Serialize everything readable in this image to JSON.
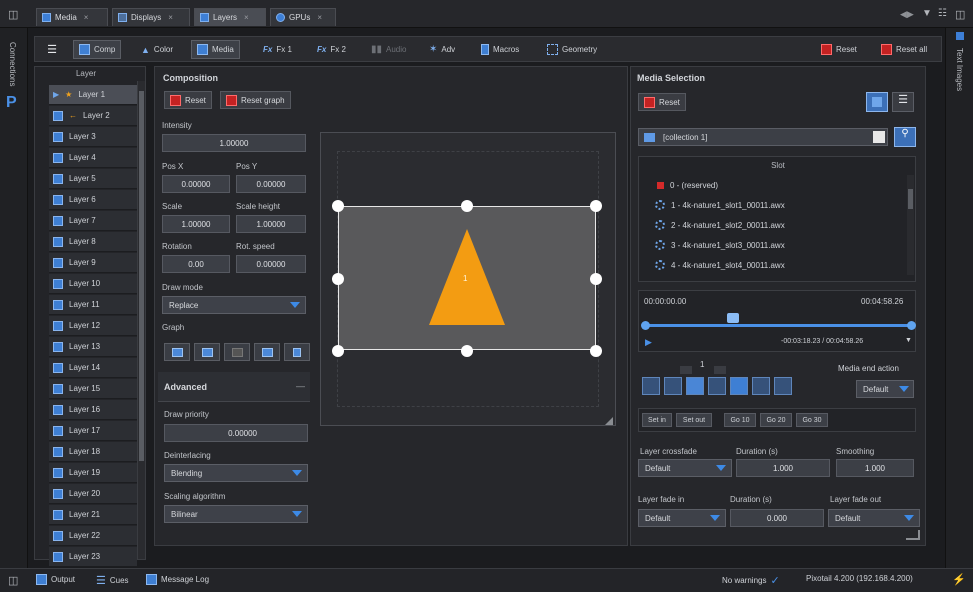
{
  "tabs": [
    {
      "label": "Media",
      "active": false
    },
    {
      "label": "Displays",
      "active": false
    },
    {
      "label": "Layers",
      "active": true
    },
    {
      "label": "GPUs",
      "active": false
    }
  ],
  "side": {
    "left_label": "Connections",
    "right_label": "Text Images",
    "logo": "P"
  },
  "toolbar": {
    "comp": "Comp",
    "color": "Color",
    "media": "Media",
    "fx1": "Fx 1",
    "fx2": "Fx 2",
    "audio": "Audio",
    "adv": "Adv",
    "macros": "Macros",
    "geometry": "Geometry",
    "reset": "Reset",
    "reset_all": "Reset all"
  },
  "layers": {
    "header": "Layer",
    "items": [
      "Layer 1",
      "Layer 2",
      "Layer 3",
      "Layer 4",
      "Layer 5",
      "Layer 6",
      "Layer 7",
      "Layer 8",
      "Layer 9",
      "Layer 10",
      "Layer 11",
      "Layer 12",
      "Layer 13",
      "Layer 14",
      "Layer 15",
      "Layer 16",
      "Layer 17",
      "Layer 18",
      "Layer 19",
      "Layer 20",
      "Layer 21",
      "Layer 22",
      "Layer 23"
    ]
  },
  "composition": {
    "title": "Composition",
    "reset": "Reset",
    "reset_graph": "Reset graph",
    "intensity_label": "Intensity",
    "intensity": "1.00000",
    "posx_label": "Pos X",
    "posx": "0.00000",
    "posy_label": "Pos Y",
    "posy": "0.00000",
    "scale_label": "Scale",
    "scale": "1.00000",
    "scale_height_label": "Scale height",
    "scale_height": "1.00000",
    "rotation_label": "Rotation",
    "rotation": "0.00",
    "rot_speed_label": "Rot. speed",
    "rot_speed": "0.00000",
    "draw_mode_label": "Draw mode",
    "draw_mode": "Replace",
    "graph_label": "Graph",
    "advanced_label": "Advanced",
    "advanced_toggle": "—",
    "draw_priority_label": "Draw priority",
    "draw_priority": "0.00000",
    "deinterlacing_label": "Deinterlacing",
    "deinterlacing": "Blending",
    "scaling_label": "Scaling algorithm",
    "scaling": "Bilinear"
  },
  "preview": {
    "layer_number": "1"
  },
  "media": {
    "title": "Media Selection",
    "reset": "Reset",
    "collection": "[collection 1]",
    "slot_header": "Slot",
    "slots": [
      "0 - (reserved)",
      "1 - 4k-nature1_slot1_00011.awx",
      "2 - 4k-nature1_slot2_00011.awx",
      "3 - 4k-nature1_slot3_00011.awx",
      "4 - 4k-nature1_slot4_00011.awx"
    ],
    "time_start": "00:00:00.00",
    "time_end": "00:04:58.26",
    "time_readout": "-00:03:18.23 / 00:04:58.26",
    "transport_number": "1",
    "media_end_label": "Media end action",
    "media_end_value": "Default",
    "set_in": "Set in",
    "set_out": "Set out",
    "go10": "Go 10",
    "go20": "Go 20",
    "go30": "Go 30",
    "crossfade_label": "Layer crossfade",
    "crossfade_value": "Default",
    "duration_label": "Duration (s)",
    "duration_value": "1.000",
    "smoothing_label": "Smoothing",
    "smoothing_value": "1.000",
    "fade_in_label": "Layer fade in",
    "fade_in_value": "Default",
    "duration2_label": "Duration (s)",
    "duration2_value": "0.000",
    "fade_out_label": "Layer fade out",
    "fade_out_value": "Default"
  },
  "bottom": {
    "output": "Output",
    "cues": "Cues",
    "message_log": "Message Log",
    "status": "No warnings",
    "version": "Pixotail 4.200 (192.168.4.200)"
  },
  "colors": {
    "accent": "#3d7fd6",
    "danger": "#c42222",
    "shape": "#f39c12"
  }
}
